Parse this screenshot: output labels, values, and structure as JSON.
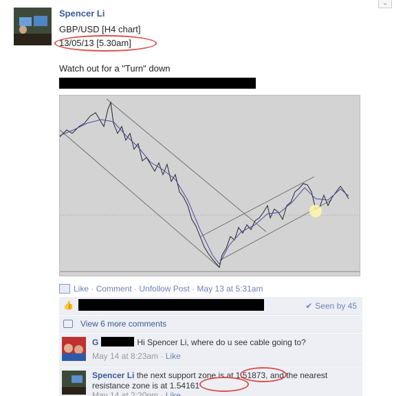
{
  "post": {
    "author": "Spencer Li",
    "line1": "GBP/USD [H4 chart]",
    "line2": "13/05/13 [5.30am]",
    "message": "Watch out for a \"Turn\" down"
  },
  "actions": {
    "like": "Like",
    "comment": "Comment",
    "unfollow": "Unfollow Post",
    "sep": " · ",
    "timestamp": "May 13 at 5:31am"
  },
  "ufi": {
    "seen": "Seen by 45",
    "view_more": "View 6 more comments"
  },
  "comments": [
    {
      "author_initial": "G",
      "text": "Hi Spencer Li, where do u see cable going to?",
      "time": "May 14 at 8:23am",
      "like": "Like"
    },
    {
      "author": "Spencer Li",
      "text_a": " the next support zone is at ",
      "support": "1.51873",
      "text_b": ", and the nearest resistance zone is at ",
      "resistance": "1.54161",
      "time": "May 14 at 2:20pm",
      "like": "Like"
    }
  ],
  "colors": {
    "link": "#3b5998",
    "annotation": "#d94f4f",
    "chart_bg": "#d3d3d3"
  },
  "icons": [
    "chevron-down-icon",
    "thumbs-up-icon",
    "checkmark-icon",
    "comment-icon",
    "photo-icon"
  ]
}
